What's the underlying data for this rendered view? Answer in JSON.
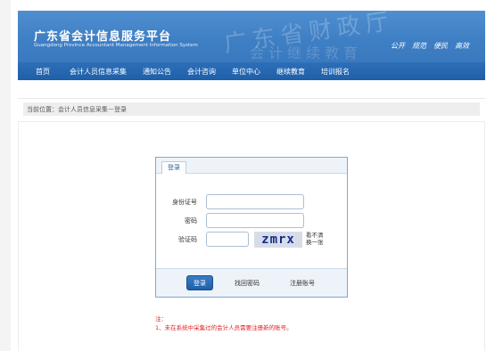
{
  "header": {
    "site_title": "广东省会计信息服务平台",
    "site_subtitle": "Guangdong Province Accountant Management Information System",
    "watermark_line1": "广东省财政厅",
    "watermark_line2": "会计继续教育",
    "top_links": [
      "公开",
      "规范",
      "便民",
      "高效"
    ]
  },
  "nav": {
    "items": [
      "首页",
      "会计人员信息采集",
      "通知公告",
      "会计咨询",
      "单位中心",
      "继续教育",
      "培训报名"
    ]
  },
  "breadcrumb": {
    "text": "当前位置：会计人员信息采集－登录"
  },
  "login": {
    "tab_label": "登录",
    "id_label": "身份证号",
    "id_value": "",
    "password_label": "密码",
    "password_value": "",
    "captcha_label": "验证码",
    "captcha_value": "",
    "captcha_image_text": "zmrx",
    "refresh_text": "看不清 换一张",
    "submit_label": "登录",
    "forgot_password": "找回密码",
    "register": "注册账号"
  },
  "notes": {
    "heading": "注：",
    "line1": "1、未在系统中采集过的会计人员需要注册新的账号。"
  },
  "colors": {
    "banner": "#3f7fc4",
    "nav": "#1f5fa8",
    "login_border": "#7ea9d6",
    "note": "#e02020"
  }
}
